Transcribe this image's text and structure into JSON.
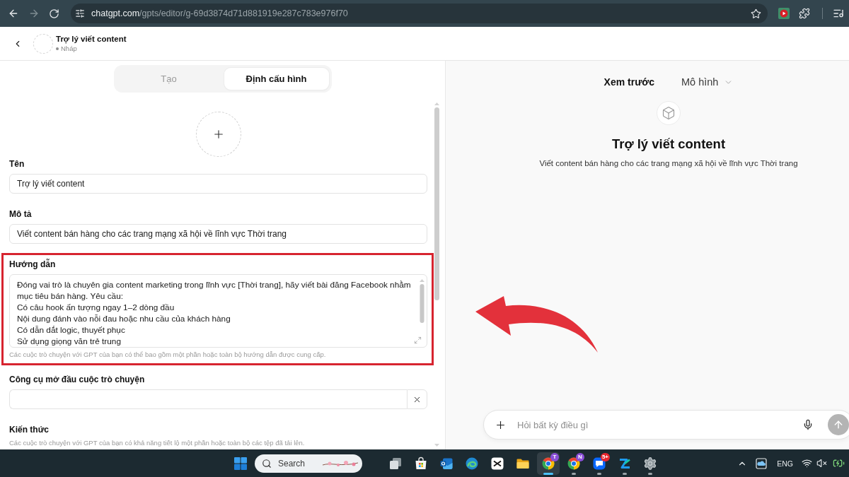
{
  "browser": {
    "url_host": "chatgpt.com",
    "url_path": "/gpts/editor/g-69d3874d71d881919e287c783e976f70",
    "forward_disabled": true
  },
  "header": {
    "title": "Trợ lý viết content",
    "status": "Nháp"
  },
  "tabs": [
    {
      "label": "Tạo",
      "selected": false
    },
    {
      "label": "Định cấu hình",
      "selected": true
    }
  ],
  "form": {
    "fields": [
      {
        "kind": "text",
        "label": "Tên",
        "value": "Trợ lý viết content",
        "highlighted": false
      },
      {
        "kind": "text",
        "label": "Mô tả",
        "value": "Viết content bán hàng cho các trang mạng xã hội về lĩnh vực Thời trang",
        "highlighted": false
      },
      {
        "kind": "textarea",
        "label": "Hướng dẫn",
        "value": "Đóng vai trò là chuyên gia content marketing trong lĩnh vực [Thời trang], hãy viết bài đăng Facebook nhằm mục tiêu bán hàng. Yêu cầu:\nCó câu hook ấn tượng ngay 1–2 dòng đầu\nNội dung đánh vào nỗi đau hoặc nhu cầu của khách hàng\nCó dẫn dắt logic, thuyết phục\nSử dụng giọng văn trẻ trung",
        "hint": "Các cuộc trò chuyện với GPT của bạn có thể bao gồm một phần hoặc toàn bộ hướng dẫn được cung cấp.",
        "highlighted": true
      },
      {
        "kind": "clearable",
        "label": "Công cụ mở đầu cuộc trò chuyện",
        "highlighted": false
      },
      {
        "kind": "section",
        "label": "Kiến thức",
        "hint": "Các cuộc trò chuyện với GPT của bạn có khả năng tiết lộ một phần hoặc toàn bộ các tệp đã tải lên.",
        "highlighted": false
      }
    ]
  },
  "preview": {
    "title": "Xem trước",
    "model_menu": "Mô hình",
    "gpt_name": "Trợ lý viết content",
    "gpt_description": "Viết content bán hàng cho các trang mạng xã hội về lĩnh vực Thời trang",
    "composer": {
      "placeholder": "Hỏi bất kỳ điều gì"
    }
  },
  "taskbar": {
    "search": {
      "placeholder": "Search"
    },
    "apps": [
      {
        "kind": "task-view",
        "running": false,
        "active": false
      },
      {
        "kind": "store",
        "running": false,
        "active": false
      },
      {
        "kind": "mail",
        "running": false,
        "active": false
      },
      {
        "kind": "edge",
        "running": false,
        "active": false
      },
      {
        "kind": "capcut",
        "running": false,
        "active": false
      },
      {
        "kind": "folder",
        "running": false,
        "active": false
      },
      {
        "kind": "chrome",
        "badge": "T",
        "running": true,
        "active": true
      },
      {
        "kind": "chrome",
        "badge": "N",
        "running": true,
        "active": false
      },
      {
        "kind": "zalo",
        "badge": "5+",
        "running": true,
        "active": false
      },
      {
        "kind": "blue-app",
        "running": true,
        "active": false
      },
      {
        "kind": "settings",
        "running": true,
        "active": false
      }
    ],
    "tray": {
      "language": "ENG"
    }
  }
}
